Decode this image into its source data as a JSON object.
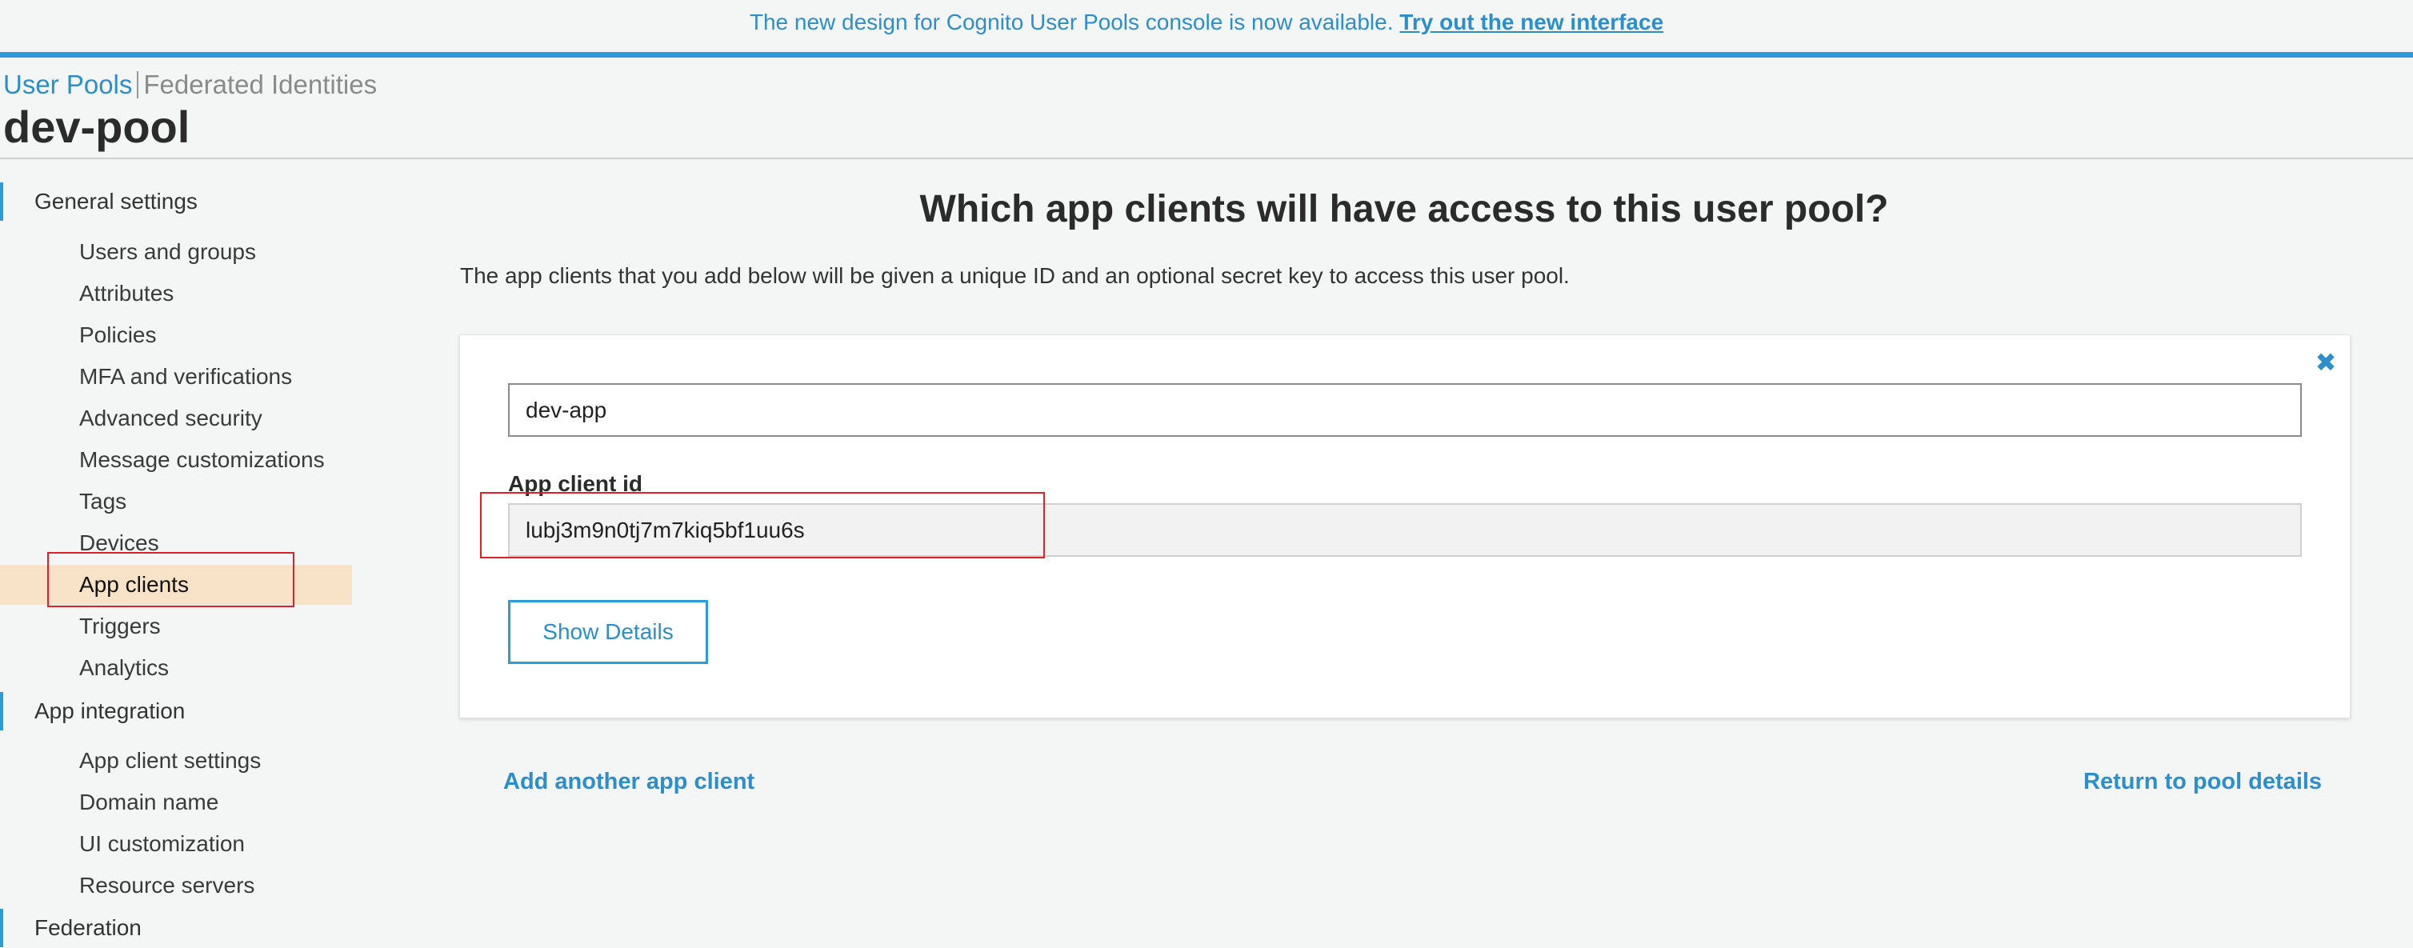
{
  "banner": {
    "text": "The new design for Cognito User Pools console is now available.",
    "link": "Try out the new interface"
  },
  "breadcrumb": {
    "user_pools": "User Pools",
    "federated": "Federated Identities"
  },
  "pool_name": "dev-pool",
  "sidebar": {
    "sections": [
      {
        "label": "General settings"
      },
      {
        "label": "App integration"
      },
      {
        "label": "Federation"
      }
    ],
    "general_items": [
      {
        "label": "Users and groups"
      },
      {
        "label": "Attributes"
      },
      {
        "label": "Policies"
      },
      {
        "label": "MFA and verifications"
      },
      {
        "label": "Advanced security"
      },
      {
        "label": "Message customizations"
      },
      {
        "label": "Tags"
      },
      {
        "label": "Devices"
      },
      {
        "label": "App clients",
        "active": true
      },
      {
        "label": "Triggers"
      },
      {
        "label": "Analytics"
      }
    ],
    "integration_items": [
      {
        "label": "App client settings"
      },
      {
        "label": "Domain name"
      },
      {
        "label": "UI customization"
      },
      {
        "label": "Resource servers"
      }
    ]
  },
  "main": {
    "heading": "Which app clients will have access to this user pool?",
    "description": "The app clients that you add below will be given a unique ID and an optional secret key to access this user pool.",
    "close_icon": "✖",
    "app_name_value": "dev-app",
    "client_id_label": "App client id",
    "client_id_value": "lubj3m9n0tj7m7kiq5bf1uu6s",
    "show_details": "Show Details",
    "add_another": "Add another app client",
    "return_link": "Return to pool details"
  },
  "colors": {
    "accent": "#2e9bd9",
    "active_bg": "#f9e3c8",
    "highlight": "#e01e26"
  }
}
